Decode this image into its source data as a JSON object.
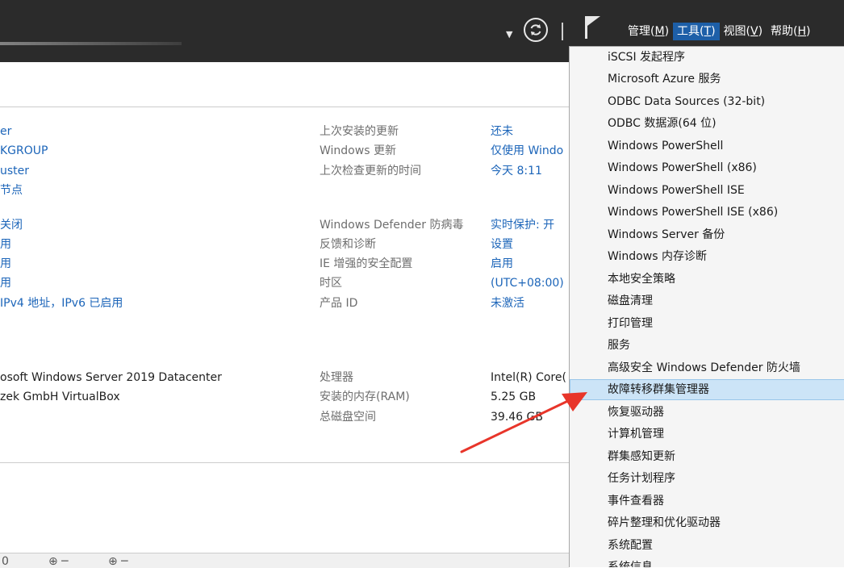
{
  "menubar": {
    "items": [
      {
        "label": "管理(",
        "key": "M",
        "suffix": ")"
      },
      {
        "label": "工具(",
        "key": "T",
        "suffix": ")"
      },
      {
        "label": "视图(",
        "key": "V",
        "suffix": ")"
      },
      {
        "label": "帮助(",
        "key": "H",
        "suffix": ")"
      }
    ]
  },
  "left_column": {
    "group1": [
      "er",
      "KGROUP",
      "uster",
      "节点"
    ],
    "group2": [
      "关闭",
      "用",
      "用",
      "用",
      "IPv4 地址，IPv6 已启用"
    ],
    "group3": [
      "osoft Windows Server 2019 Datacenter",
      "zek GmbH VirtualBox"
    ]
  },
  "mid_column": {
    "group1": [
      "上次安装的更新",
      "Windows 更新",
      "上次检查更新的时间"
    ],
    "group2": [
      "Windows Defender 防病毒",
      "反馈和诊断",
      "IE 增强的安全配置",
      "时区",
      "产品 ID"
    ],
    "group3": [
      "处理器",
      "安装的内存(RAM)",
      "总磁盘空间"
    ]
  },
  "value_column": {
    "group1": [
      "还未",
      "仅使用 Windo",
      "今天 8:11"
    ],
    "group2": [
      "实时保护: 开",
      "设置",
      "启用",
      "(UTC+08:00)",
      "未激活"
    ],
    "group3": [
      "Intel(R) Core(",
      "5.25 GB",
      "39.46 GB"
    ]
  },
  "bottom": {
    "c1": "0",
    "c2": "⊕ ─",
    "c3": "⊕ ─"
  },
  "tools_menu": {
    "items": [
      "iSCSI 发起程序",
      "Microsoft Azure 服务",
      "ODBC Data Sources (32-bit)",
      "ODBC 数据源(64 位)",
      "Windows PowerShell",
      "Windows PowerShell (x86)",
      "Windows PowerShell ISE",
      "Windows PowerShell ISE (x86)",
      "Windows Server 备份",
      "Windows 内存诊断",
      "本地安全策略",
      "磁盘清理",
      "打印管理",
      "服务",
      "高级安全 Windows Defender 防火墙",
      "故障转移群集管理器",
      "恢复驱动器",
      "计算机管理",
      "群集感知更新",
      "任务计划程序",
      "事件查看器",
      "碎片整理和优化驱动器",
      "系统配置",
      "系统信息"
    ],
    "highlighted_index": 15
  },
  "colors": {
    "titlebar": "#2b2b2b",
    "link": "#1c65b9",
    "highlight": "#cce4f7",
    "arrow": "#e8352a"
  }
}
